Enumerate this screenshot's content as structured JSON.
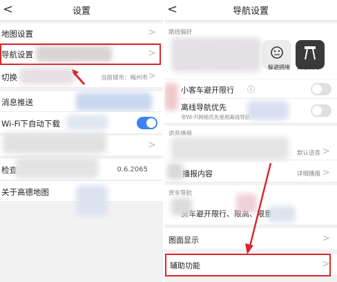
{
  "left": {
    "back": "<",
    "title": "设置",
    "items": [
      {
        "label": "地图设置"
      },
      {
        "label": "导航设置"
      },
      {
        "label": "切换",
        "value": "当前城市：梅州市"
      },
      {
        "label": "消息推送"
      },
      {
        "label": "Wi-Fi下自动下载"
      },
      {
        "label": "检查",
        "value": "0.6.2065"
      },
      {
        "label": "关于高德地图"
      }
    ],
    "chevron": ">"
  },
  "right": {
    "back": "<",
    "title": "导航设置",
    "section_route": "路线偏好",
    "pref_options": [
      "躲避拥堵",
      "高速优先"
    ],
    "car_restriction": "小客车避开限行",
    "info_icon": "ⓘ",
    "offline_nav": "离线导航优先",
    "offline_sub": "非Wi-Fi网络优先使用离线导航",
    "section_voice": "语音播报",
    "voice_value": "默认语音",
    "broadcast_label": "播报内容",
    "broadcast_value": "详细播报",
    "section_truck": "货车导航",
    "truck_label": "货车避开限行、限高、限重",
    "display_label": "图面显示",
    "assist_label": "辅助功能",
    "chevron": ">"
  },
  "colors": {
    "highlight": "#d8262e",
    "toggle_on": "#3b82f6",
    "background": "#f2f2f2"
  }
}
